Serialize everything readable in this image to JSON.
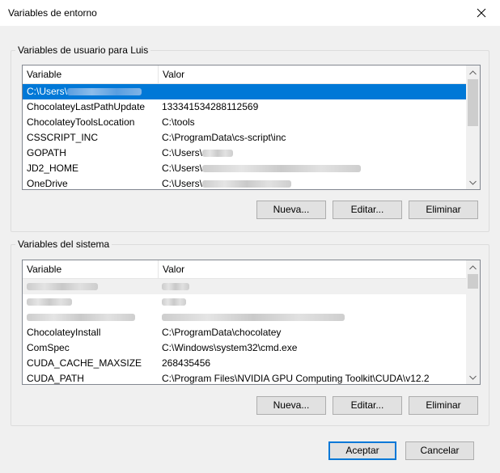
{
  "window": {
    "title": "Variables de entorno",
    "close_icon": "close-icon"
  },
  "user_section": {
    "label": "Variables de usuario para Luis",
    "columns": [
      "Variable",
      "Valor"
    ],
    "rows": [
      {
        "variable": "C:\\Users\\",
        "value": ""
      },
      {
        "variable": "ChocolateyLastPathUpdate",
        "value": "133341534288112569"
      },
      {
        "variable": "ChocolateyToolsLocation",
        "value": "C:\\tools"
      },
      {
        "variable": "CSSCRIPT_INC",
        "value": "C:\\ProgramData\\cs-script\\inc"
      },
      {
        "variable": "GOPATH",
        "value": "C:\\Users\\"
      },
      {
        "variable": "JD2_HOME",
        "value": "C:\\Users\\"
      },
      {
        "variable": "OneDrive",
        "value": "C:\\Users\\"
      }
    ],
    "buttons": {
      "new": "Nueva...",
      "edit": "Editar...",
      "delete": "Eliminar"
    }
  },
  "system_section": {
    "label": "Variables del sistema",
    "columns": [
      "Variable",
      "Valor"
    ],
    "rows": [
      {
        "variable": "",
        "value": ""
      },
      {
        "variable": "",
        "value": ""
      },
      {
        "variable": "",
        "value": ""
      },
      {
        "variable": "ChocolateyInstall",
        "value": "C:\\ProgramData\\chocolatey"
      },
      {
        "variable": "ComSpec",
        "value": "C:\\Windows\\system32\\cmd.exe"
      },
      {
        "variable": "CUDA_CACHE_MAXSIZE",
        "value": "268435456"
      },
      {
        "variable": "CUDA_PATH",
        "value": "C:\\Program Files\\NVIDIA GPU Computing Toolkit\\CUDA\\v12.2"
      }
    ],
    "buttons": {
      "new": "Nueva...",
      "edit": "Editar...",
      "delete": "Eliminar"
    }
  },
  "footer": {
    "ok": "Aceptar",
    "cancel": "Cancelar"
  },
  "colors": {
    "selection": "#0078d7",
    "background": "#f0f0f0",
    "default_button_border": "#0078d7"
  }
}
